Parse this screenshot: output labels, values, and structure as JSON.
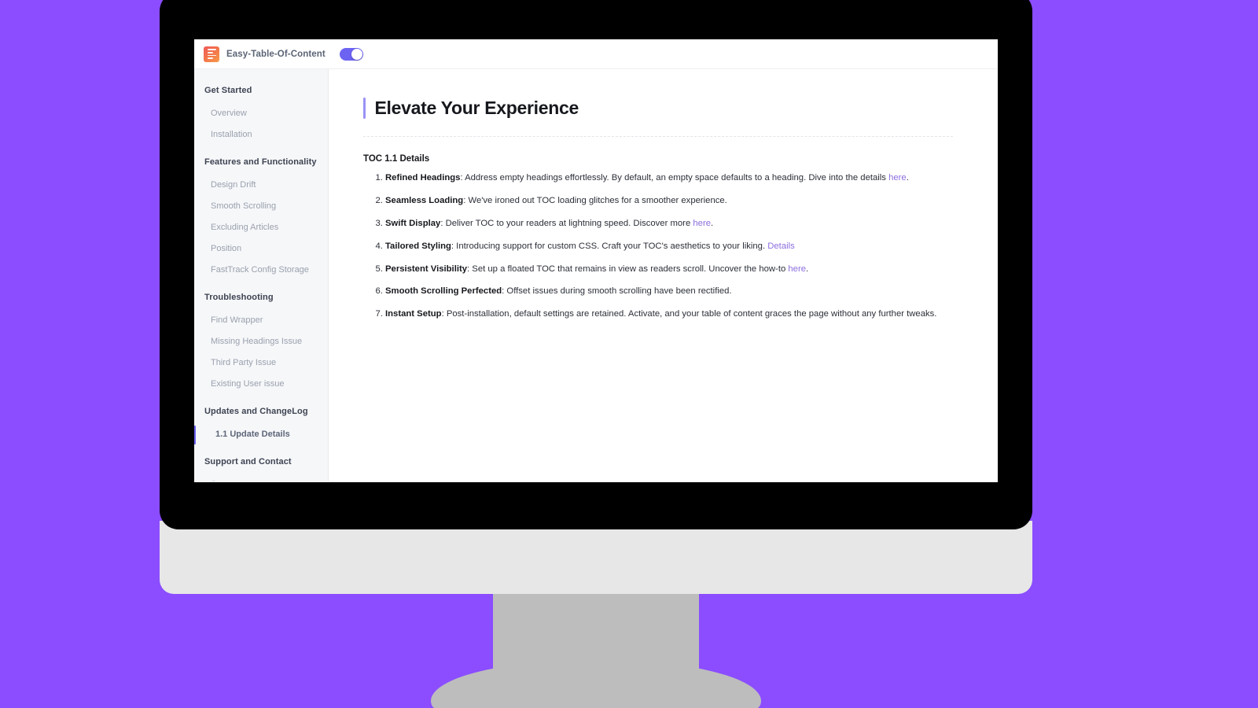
{
  "theme": {
    "background_color": "#8B4DFF",
    "accent_color": "#6c63f2",
    "link_color": "#8c6ee0",
    "logo_gradient_from": "#f05a5a",
    "logo_gradient_to": "#f79b4a"
  },
  "topbar": {
    "logo_icon": "list-lines-icon",
    "brand_title": "Easy-Table-Of-Content",
    "sidebar_toggle": {
      "name": "sidebar-toggle",
      "state": "on"
    }
  },
  "sidebar": {
    "sections": [
      {
        "title": "Get Started",
        "items": [
          {
            "label": "Overview",
            "active": false
          },
          {
            "label": "Installation",
            "active": false
          }
        ]
      },
      {
        "title": "Features and Functionality",
        "items": [
          {
            "label": "Design Drift",
            "active": false
          },
          {
            "label": "Smooth Scrolling",
            "active": false
          },
          {
            "label": "Excluding Articles",
            "active": false
          },
          {
            "label": "Position",
            "active": false
          },
          {
            "label": "FastTrack Config Storage",
            "active": false
          }
        ]
      },
      {
        "title": "Troubleshooting",
        "items": [
          {
            "label": "Find Wrapper",
            "active": false
          },
          {
            "label": "Missing Headings Issue",
            "active": false
          },
          {
            "label": "Third Party Issue",
            "active": false
          },
          {
            "label": "Existing User issue",
            "active": false
          }
        ]
      },
      {
        "title": "Updates and ChangeLog",
        "items": [
          {
            "label": "1.1 Update Details",
            "active": true
          }
        ]
      },
      {
        "title": "Support and Contact",
        "items": [
          {
            "label": "Support",
            "active": false
          }
        ]
      }
    ]
  },
  "content": {
    "page_title": "Elevate Your Experience",
    "subsection_title": "TOC 1.1 Details",
    "features": [
      {
        "lead": "Refined Headings",
        "body_before": ": Address empty headings effortlessly. By default, an empty space defaults to a heading. Dive into the details ",
        "link": "here",
        "body_after": "."
      },
      {
        "lead": "Seamless Loading",
        "body_before": ": We've ironed out TOC loading glitches for a smoother experience.",
        "link": "",
        "body_after": ""
      },
      {
        "lead": "Swift Display",
        "body_before": ": Deliver TOC to your readers at lightning speed. Discover more ",
        "link": "here",
        "body_after": "."
      },
      {
        "lead": "Tailored Styling",
        "body_before": ": Introducing support for custom CSS. Craft your TOC's aesthetics to your liking. ",
        "link": "Details",
        "body_after": ""
      },
      {
        "lead": "Persistent Visibility",
        "body_before": ": Set up a floated TOC that remains in view as readers scroll. Uncover the how-to ",
        "link": "here",
        "body_after": "."
      },
      {
        "lead": "Smooth Scrolling Perfected",
        "body_before": ": Offset issues during smooth scrolling have been rectified.",
        "link": "",
        "body_after": ""
      },
      {
        "lead": "Instant Setup",
        "body_before": ": Post-installation, default settings are retained. Activate, and your table of content graces the page without any further tweaks.",
        "link": "",
        "body_after": ""
      }
    ]
  }
}
